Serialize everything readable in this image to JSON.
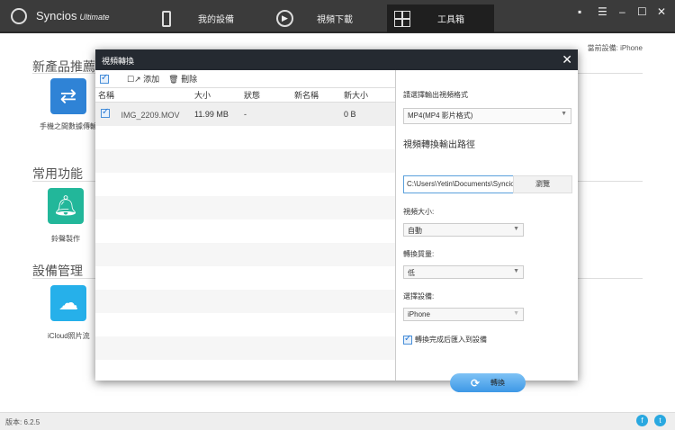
{
  "app": {
    "name": "Syncios",
    "edition": "Ultimate"
  },
  "nav": [
    {
      "label": "我的設備",
      "icon": "phone-icon"
    },
    {
      "label": "視頻下載",
      "icon": "play-icon"
    },
    {
      "label": "工具箱",
      "icon": "toolbox-icon"
    }
  ],
  "current_device": "當前設備: iPhone",
  "sections": [
    {
      "title": "新產品推薦",
      "tile": {
        "label": "手機之間數據傳輸",
        "color": "#2f83d6"
      }
    },
    {
      "title": "常用功能",
      "tile": {
        "label": "鈴聲製作",
        "color": "#22b79a"
      }
    },
    {
      "title": "設備管理",
      "tile": {
        "label": "iCloud照片流",
        "color": "#26b0ea"
      }
    }
  ],
  "version": "版本: 6.2.5",
  "dialog": {
    "title": "視頻轉換",
    "toolbar": {
      "add": "添加",
      "delete": "刪除"
    },
    "columns": [
      "名稱",
      "大小",
      "狀態",
      "新名稱",
      "新大小"
    ],
    "rows": [
      {
        "name": "IMG_2209.MOV",
        "size": "11.99 MB",
        "status": "-",
        "new_name": "",
        "new_size": "0 B"
      }
    ],
    "format_label": "請選擇輸出視頻格式",
    "format_value": "MP4(MP4 影片格式)",
    "path_label": "視頻轉換輸出路徑",
    "path_value": "C:\\Users\\Yetin\\Documents\\Syncios",
    "browse": "瀏覽",
    "size_label": "視頻大小:",
    "size_value": "自動",
    "quality_label": "轉換質量:",
    "quality_value": "低",
    "device_label": "選擇設備:",
    "device_value": "iPhone",
    "import_check": "轉換完成后匯入到設備",
    "convert": "轉換"
  }
}
